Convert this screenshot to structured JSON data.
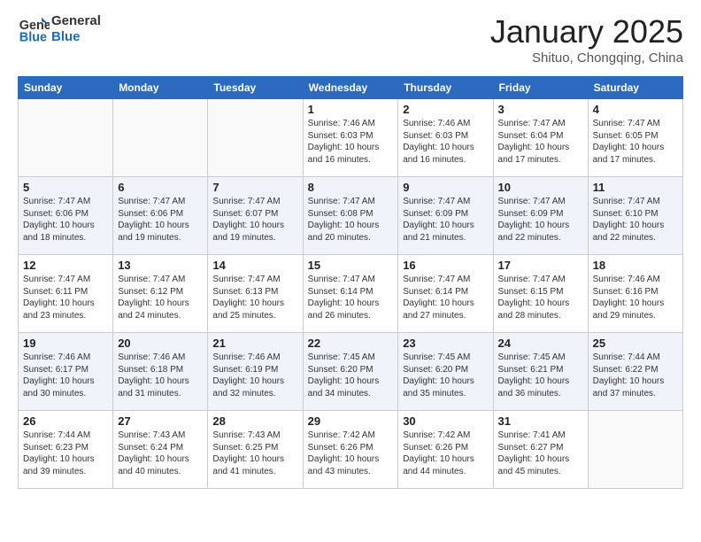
{
  "logo": {
    "text_general": "General",
    "text_blue": "Blue"
  },
  "title": "January 2025",
  "subtitle": "Shituo, Chongqing, China",
  "days_of_week": [
    "Sunday",
    "Monday",
    "Tuesday",
    "Wednesday",
    "Thursday",
    "Friday",
    "Saturday"
  ],
  "weeks": [
    [
      {
        "day": "",
        "info": ""
      },
      {
        "day": "",
        "info": ""
      },
      {
        "day": "",
        "info": ""
      },
      {
        "day": "1",
        "info": "Sunrise: 7:46 AM\nSunset: 6:03 PM\nDaylight: 10 hours and 16 minutes."
      },
      {
        "day": "2",
        "info": "Sunrise: 7:46 AM\nSunset: 6:03 PM\nDaylight: 10 hours and 16 minutes."
      },
      {
        "day": "3",
        "info": "Sunrise: 7:47 AM\nSunset: 6:04 PM\nDaylight: 10 hours and 17 minutes."
      },
      {
        "day": "4",
        "info": "Sunrise: 7:47 AM\nSunset: 6:05 PM\nDaylight: 10 hours and 17 minutes."
      }
    ],
    [
      {
        "day": "5",
        "info": "Sunrise: 7:47 AM\nSunset: 6:06 PM\nDaylight: 10 hours and 18 minutes."
      },
      {
        "day": "6",
        "info": "Sunrise: 7:47 AM\nSunset: 6:06 PM\nDaylight: 10 hours and 19 minutes."
      },
      {
        "day": "7",
        "info": "Sunrise: 7:47 AM\nSunset: 6:07 PM\nDaylight: 10 hours and 19 minutes."
      },
      {
        "day": "8",
        "info": "Sunrise: 7:47 AM\nSunset: 6:08 PM\nDaylight: 10 hours and 20 minutes."
      },
      {
        "day": "9",
        "info": "Sunrise: 7:47 AM\nSunset: 6:09 PM\nDaylight: 10 hours and 21 minutes."
      },
      {
        "day": "10",
        "info": "Sunrise: 7:47 AM\nSunset: 6:09 PM\nDaylight: 10 hours and 22 minutes."
      },
      {
        "day": "11",
        "info": "Sunrise: 7:47 AM\nSunset: 6:10 PM\nDaylight: 10 hours and 22 minutes."
      }
    ],
    [
      {
        "day": "12",
        "info": "Sunrise: 7:47 AM\nSunset: 6:11 PM\nDaylight: 10 hours and 23 minutes."
      },
      {
        "day": "13",
        "info": "Sunrise: 7:47 AM\nSunset: 6:12 PM\nDaylight: 10 hours and 24 minutes."
      },
      {
        "day": "14",
        "info": "Sunrise: 7:47 AM\nSunset: 6:13 PM\nDaylight: 10 hours and 25 minutes."
      },
      {
        "day": "15",
        "info": "Sunrise: 7:47 AM\nSunset: 6:14 PM\nDaylight: 10 hours and 26 minutes."
      },
      {
        "day": "16",
        "info": "Sunrise: 7:47 AM\nSunset: 6:14 PM\nDaylight: 10 hours and 27 minutes."
      },
      {
        "day": "17",
        "info": "Sunrise: 7:47 AM\nSunset: 6:15 PM\nDaylight: 10 hours and 28 minutes."
      },
      {
        "day": "18",
        "info": "Sunrise: 7:46 AM\nSunset: 6:16 PM\nDaylight: 10 hours and 29 minutes."
      }
    ],
    [
      {
        "day": "19",
        "info": "Sunrise: 7:46 AM\nSunset: 6:17 PM\nDaylight: 10 hours and 30 minutes."
      },
      {
        "day": "20",
        "info": "Sunrise: 7:46 AM\nSunset: 6:18 PM\nDaylight: 10 hours and 31 minutes."
      },
      {
        "day": "21",
        "info": "Sunrise: 7:46 AM\nSunset: 6:19 PM\nDaylight: 10 hours and 32 minutes."
      },
      {
        "day": "22",
        "info": "Sunrise: 7:45 AM\nSunset: 6:20 PM\nDaylight: 10 hours and 34 minutes."
      },
      {
        "day": "23",
        "info": "Sunrise: 7:45 AM\nSunset: 6:20 PM\nDaylight: 10 hours and 35 minutes."
      },
      {
        "day": "24",
        "info": "Sunrise: 7:45 AM\nSunset: 6:21 PM\nDaylight: 10 hours and 36 minutes."
      },
      {
        "day": "25",
        "info": "Sunrise: 7:44 AM\nSunset: 6:22 PM\nDaylight: 10 hours and 37 minutes."
      }
    ],
    [
      {
        "day": "26",
        "info": "Sunrise: 7:44 AM\nSunset: 6:23 PM\nDaylight: 10 hours and 39 minutes."
      },
      {
        "day": "27",
        "info": "Sunrise: 7:43 AM\nSunset: 6:24 PM\nDaylight: 10 hours and 40 minutes."
      },
      {
        "day": "28",
        "info": "Sunrise: 7:43 AM\nSunset: 6:25 PM\nDaylight: 10 hours and 41 minutes."
      },
      {
        "day": "29",
        "info": "Sunrise: 7:42 AM\nSunset: 6:26 PM\nDaylight: 10 hours and 43 minutes."
      },
      {
        "day": "30",
        "info": "Sunrise: 7:42 AM\nSunset: 6:26 PM\nDaylight: 10 hours and 44 minutes."
      },
      {
        "day": "31",
        "info": "Sunrise: 7:41 AM\nSunset: 6:27 PM\nDaylight: 10 hours and 45 minutes."
      },
      {
        "day": "",
        "info": ""
      }
    ]
  ]
}
